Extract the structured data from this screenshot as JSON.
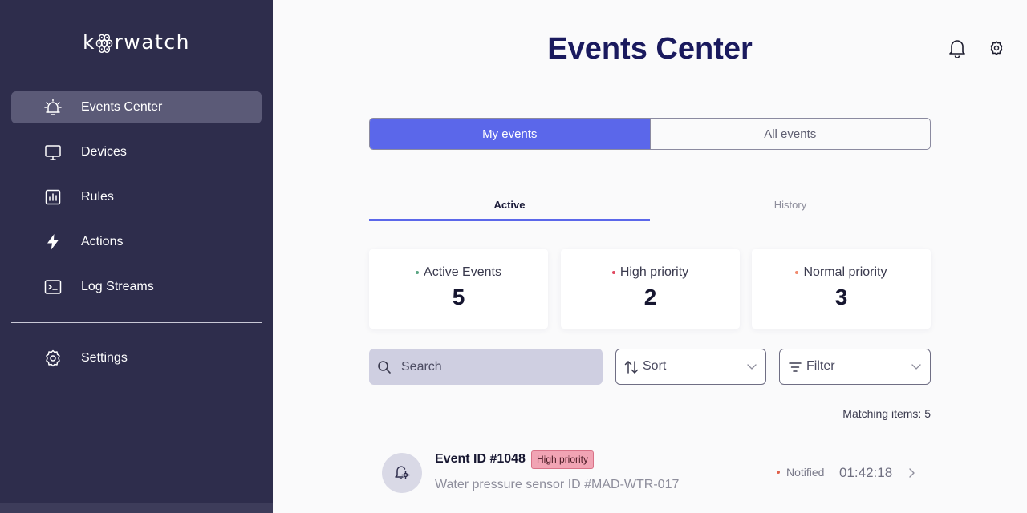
{
  "app": {
    "logo": "kꙮrwatch"
  },
  "sidebar": {
    "items": [
      {
        "label": "Events Center",
        "icon": "alarm-bell-icon",
        "active": true
      },
      {
        "label": "Devices",
        "icon": "monitor-icon"
      },
      {
        "label": "Rules",
        "icon": "bar-chart-icon"
      },
      {
        "label": "Actions",
        "icon": "lightning-icon"
      },
      {
        "label": "Log Streams",
        "icon": "terminal-icon"
      }
    ],
    "settings": {
      "label": "Settings",
      "icon": "gear-icon"
    }
  },
  "header": {
    "title": "Events Center",
    "icons": [
      "bell-icon",
      "gear-icon"
    ]
  },
  "segment": {
    "options": [
      "My events",
      "All events"
    ],
    "selected": "My events"
  },
  "tabs": {
    "options": [
      "Active",
      "History"
    ],
    "selected": "Active"
  },
  "stats": [
    {
      "label": "Active Events",
      "value": "5",
      "dot_color": "#5aa582"
    },
    {
      "label": "High priority",
      "value": "2",
      "dot_color": "#e0485f"
    },
    {
      "label": "Normal priority",
      "value": "3",
      "dot_color": "#f08a6e"
    }
  ],
  "toolbar": {
    "search": {
      "placeholder": "Search"
    },
    "sort": {
      "label": "Sort"
    },
    "filter": {
      "label": "Filter"
    }
  },
  "matching": "Matching items: 5",
  "events": [
    {
      "id": "Event ID #1048",
      "badge": "High priority",
      "subtitle": "Water pressure sensor ID #MAD-WTR-017",
      "status": "Notified",
      "status_color": "#e0604a",
      "time": "01:42:18"
    }
  ],
  "colors": {
    "sidebar": "#2e2d4c",
    "accent": "#5b67ea",
    "title": "#1a1a5e"
  }
}
